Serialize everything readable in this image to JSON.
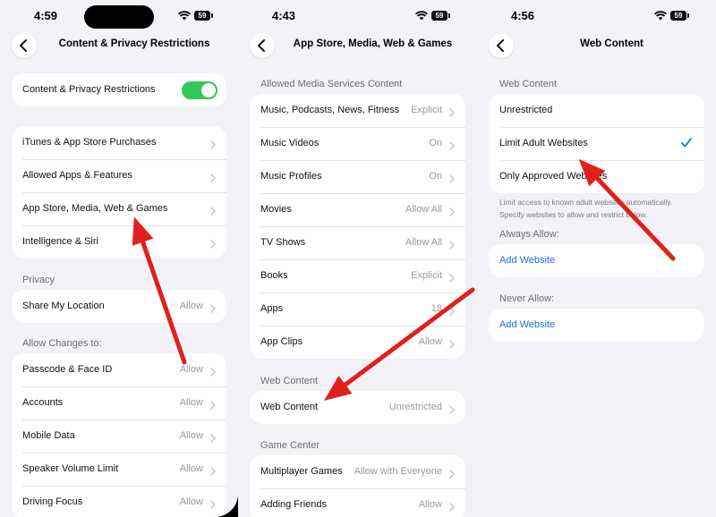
{
  "colors": {
    "accent": "#1a72d4",
    "toggle_on": "#34c759",
    "arrow": "#e0201e",
    "background": "#f2f2f7"
  },
  "screen1": {
    "time": "4:59",
    "battery": "59",
    "title": "Content & Privacy Restrictions",
    "toggle_row": {
      "label": "Content & Privacy Restrictions",
      "on": true
    },
    "group1": [
      {
        "label": "iTunes & App Store Purchases"
      },
      {
        "label": "Allowed Apps & Features"
      },
      {
        "label": "App Store, Media, Web & Games"
      },
      {
        "label": "Intelligence & Siri"
      }
    ],
    "privacy_header": "Privacy",
    "privacy": [
      {
        "label": "Share My Location",
        "value": "Allow"
      }
    ],
    "allow_changes_header": "Allow Changes to:",
    "allow_changes": [
      {
        "label": "Passcode & Face ID",
        "value": "Allow"
      },
      {
        "label": "Accounts",
        "value": "Allow"
      },
      {
        "label": "Mobile Data",
        "value": "Allow"
      },
      {
        "label": "Speaker Volume Limit",
        "value": "Allow"
      },
      {
        "label": "Driving Focus",
        "value": "Allow"
      }
    ]
  },
  "screen2": {
    "time": "4:43",
    "battery": "59",
    "title": "App Store, Media, Web & Games",
    "media_header": "Allowed Media Services Content",
    "media": [
      {
        "label": "Music, Podcasts, News, Fitness",
        "value": "Explicit"
      },
      {
        "label": "Music Videos",
        "value": "On"
      },
      {
        "label": "Music Profiles",
        "value": "On"
      },
      {
        "label": "Movies",
        "value": "Allow All"
      },
      {
        "label": "TV Shows",
        "value": "Allow All"
      },
      {
        "label": "Books",
        "value": "Explicit"
      },
      {
        "label": "Apps",
        "value": "18"
      },
      {
        "label": "App Clips",
        "value": "Allow"
      }
    ],
    "web_header": "Web Content",
    "web": [
      {
        "label": "Web Content",
        "value": "Unrestricted"
      }
    ],
    "game_header": "Game Center",
    "game": [
      {
        "label": "Multiplayer Games",
        "value": "Allow with Everyone"
      },
      {
        "label": "Adding Friends",
        "value": "Allow"
      }
    ]
  },
  "screen3": {
    "time": "4:56",
    "battery": "59",
    "title": "Web Content",
    "web_header": "Web Content",
    "options": [
      {
        "label": "Unrestricted",
        "selected": false
      },
      {
        "label": "Limit Adult Websites",
        "selected": true
      },
      {
        "label": "Only Approved Websites",
        "selected": false
      }
    ],
    "footnote": "Limit access to known adult websites automatically. Specify websites to allow and restrict below.",
    "always_allow_header": "Always Allow:",
    "always_allow_action": "Add Website",
    "never_allow_header": "Never Allow:",
    "never_allow_action": "Add Website"
  }
}
